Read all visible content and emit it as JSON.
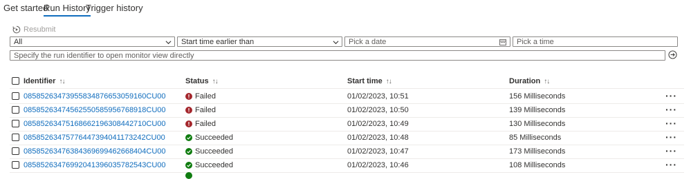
{
  "tabs": [
    {
      "label": "Get started"
    },
    {
      "label": "Run History"
    },
    {
      "label": "Trigger history"
    }
  ],
  "toolbar": {
    "resubmit_label": "Resubmit"
  },
  "filters": {
    "status_value": "All",
    "time_filter_value": "Start time earlier than",
    "date_placeholder": "Pick a date",
    "time_placeholder": "Pick a time",
    "run_id_placeholder": "Specify the run identifier to open monitor view directly"
  },
  "table": {
    "columns": {
      "identifier": "Identifier",
      "status": "Status",
      "start_time": "Start time",
      "duration": "Duration"
    },
    "rows": [
      {
        "id": "08585263473955834876653059160CU00",
        "status": "Failed",
        "start": "01/02/2023, 10:51",
        "duration": "156 Milliseconds"
      },
      {
        "id": "08585263474562550585956768918CU00",
        "status": "Failed",
        "start": "01/02/2023, 10:50",
        "duration": "139 Milliseconds"
      },
      {
        "id": "08585263475168662196308442710CU00",
        "status": "Failed",
        "start": "01/02/2023, 10:49",
        "duration": "130 Milliseconds"
      },
      {
        "id": "08585263475776447394041173242CU00",
        "status": "Succeeded",
        "start": "01/02/2023, 10:48",
        "duration": "85 Milliseconds"
      },
      {
        "id": "08585263476384369699462668404CU00",
        "status": "Succeeded",
        "start": "01/02/2023, 10:47",
        "duration": "173 Milliseconds"
      },
      {
        "id": "08585263476992041396035782543CU00",
        "status": "Succeeded",
        "start": "01/02/2023, 10:46",
        "duration": "108 Milliseconds"
      }
    ]
  },
  "icons": {
    "more": "more-options-icon",
    "sort": "sort-icon",
    "failed": "error-circle-icon",
    "succeeded": "check-circle-icon"
  },
  "colors": {
    "accent": "#0f6cbd",
    "failed": "#a4262c",
    "succeeded": "#107c10"
  }
}
